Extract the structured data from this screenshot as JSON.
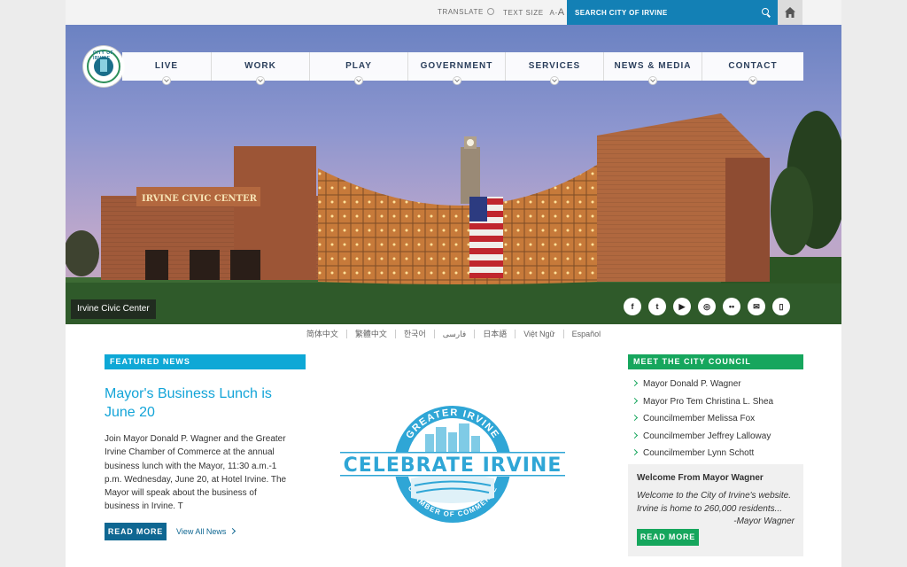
{
  "utility": {
    "translate_label": "TRANSLATE",
    "text_size_label": "TEXT SIZE",
    "text_size_small": "A",
    "text_size_sep": "-",
    "text_size_large": "A",
    "search_placeholder": "SEARCH CITY OF IRVINE"
  },
  "logo": {
    "text": "CITY OF IRVINE"
  },
  "nav": [
    {
      "label": "LIVE"
    },
    {
      "label": "WORK"
    },
    {
      "label": "PLAY"
    },
    {
      "label": "GOVERNMENT"
    },
    {
      "label": "SERVICES"
    },
    {
      "label": "NEWS & MEDIA"
    },
    {
      "label": "CONTACT"
    }
  ],
  "hero": {
    "caption": "Irvine Civic Center",
    "building_sign": "IRVINE CIVIC CENTER"
  },
  "social": [
    {
      "icon": "facebook-icon",
      "glyph": "f"
    },
    {
      "icon": "twitter-icon",
      "glyph": "t"
    },
    {
      "icon": "youtube-icon",
      "glyph": "▶"
    },
    {
      "icon": "instagram-icon",
      "glyph": "◎"
    },
    {
      "icon": "flickr-icon",
      "glyph": "••"
    },
    {
      "icon": "email-icon",
      "glyph": "✉"
    },
    {
      "icon": "mobile-icon",
      "glyph": "▯"
    }
  ],
  "languages": [
    "简体中文",
    "繁體中文",
    "한국어",
    "فارسی",
    "日本語",
    "Việt Ngữ",
    "Español"
  ],
  "featured_news": {
    "header": "FEATURED NEWS",
    "title": "Mayor's Business Lunch is June 20",
    "body": "Join Mayor Donald P. Wagner and the Greater Irvine Chamber of Commerce at the annual business lunch with the Mayor, 11:30 a.m.-1 p.m. Wednesday, June 20, at Hotel Irvine. The Mayor will speak about the business of business in Irvine. T",
    "read_more": "READ MORE",
    "view_all": "View All News"
  },
  "badge": {
    "top_text": "GREATER IRVINE",
    "main_text": "CELEBRATE IRVINE",
    "bottom_text": "CHAMBER OF COMMERCE"
  },
  "council": {
    "header": "MEET THE CITY COUNCIL",
    "members": [
      "Mayor Donald P. Wagner",
      "Mayor Pro Tem Christina L. Shea",
      "Councilmember Melissa Fox",
      "Councilmember Jeffrey Lalloway",
      "Councilmember Lynn Schott"
    ]
  },
  "welcome": {
    "title": "Welcome From Mayor Wagner",
    "text": "Welcome to the City of Irvine's website. Irvine is home to 260,000 residents...",
    "signature": "-Mayor Wagner",
    "read_more": "READ MORE"
  },
  "colors": {
    "search_bg": "#1380b5",
    "featured_header": "#0ea8d6",
    "council_header": "#16a65d",
    "nav_text": "#2b3f5c"
  }
}
